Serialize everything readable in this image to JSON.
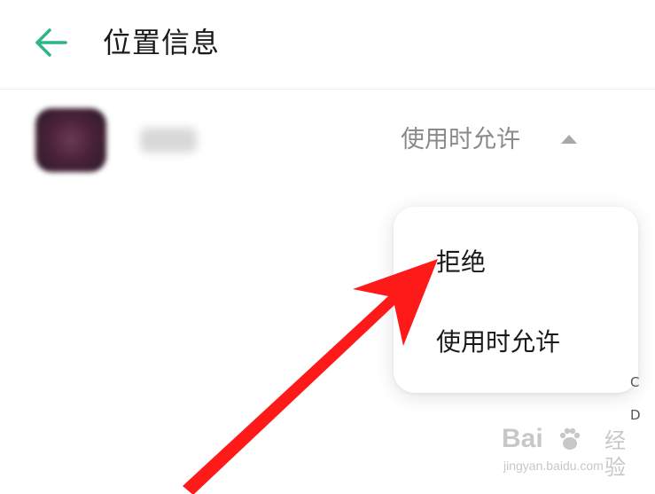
{
  "header": {
    "title": "位置信息",
    "back_icon": "arrow-left-icon",
    "accent_color": "#2bb58a"
  },
  "app_row": {
    "icon": "app-icon",
    "permission_value": "使用时允许",
    "caret_icon": "caret-up-icon"
  },
  "dropdown": {
    "options": [
      "拒绝",
      "使用时允许"
    ]
  },
  "edge_letters": [
    "C",
    "D"
  ],
  "annotation": {
    "arrow_color": "#ff1a1a"
  },
  "watermark": {
    "brand": "Bai",
    "brand_suffix": "经验",
    "url": "jingyan.baidu.com"
  }
}
